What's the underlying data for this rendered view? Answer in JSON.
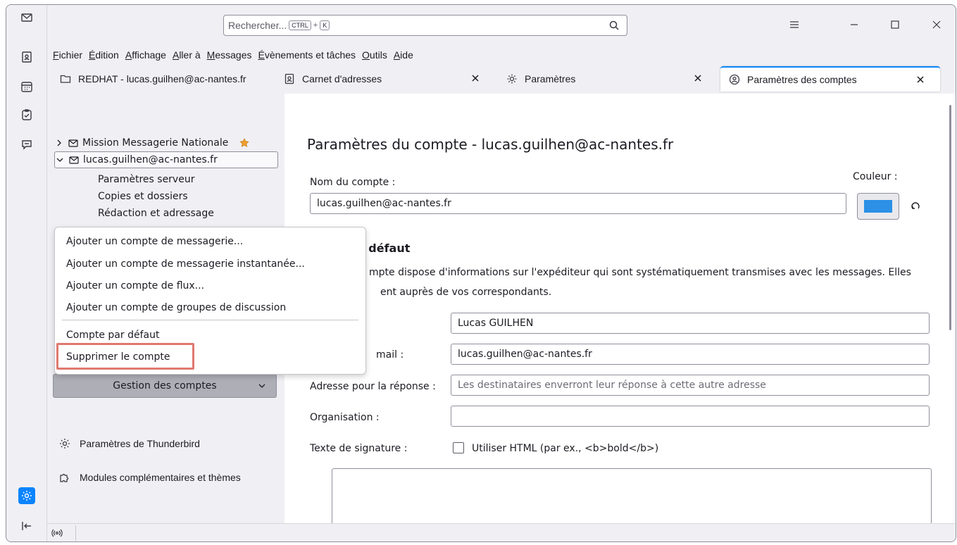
{
  "search": {
    "placeholder": "Rechercher...",
    "kbd_ctrl": "CTRL",
    "kbd_plus": "+",
    "kbd_key": "K"
  },
  "menubar": [
    "Fichier",
    "Édition",
    "Affichage",
    "Aller à",
    "Messages",
    "Évènements et tâches",
    "Outils",
    "Aide"
  ],
  "tabs": [
    {
      "label": "REDHAT - lucas.guilhen@ac-nantes.fr",
      "icon": "folder-icon"
    },
    {
      "label": "Carnet d'adresses",
      "icon": "address-book-icon"
    },
    {
      "label": "Paramètres",
      "icon": "gear-icon"
    },
    {
      "label": "Paramètres des comptes",
      "icon": "account-settings-icon"
    }
  ],
  "sidebar": {
    "accounts": [
      {
        "label": "Mission Messagerie Nationale",
        "expanded": false
      },
      {
        "label": "lucas.guilhen@ac-nantes.fr",
        "expanded": true
      }
    ],
    "subitems": [
      "Paramètres serveur",
      "Copies et dossiers",
      "Rédaction et adressage"
    ],
    "gestion_label": "Gestion des comptes",
    "links": [
      {
        "label": "Paramètres de Thunderbird",
        "icon": "gear-icon"
      },
      {
        "label": "Modules complémentaires et thèmes",
        "icon": "puzzle-icon"
      }
    ]
  },
  "popup": {
    "items": [
      "Ajouter un compte de messagerie...",
      "Ajouter un compte de messagerie instantanée...",
      "Ajouter un compte de flux...",
      "Ajouter un compte de groupes de discussion",
      "Compte par défaut",
      "Supprimer le compte"
    ]
  },
  "main": {
    "title": "Paramètres du compte - lucas.guilhen@ac-nantes.fr",
    "account_name_label": "Nom du compte :",
    "account_name_value": "lucas.guilhen@ac-nantes.fr",
    "color_label": "Couleur :",
    "color_value": "#2b90e6",
    "identity_heading_partial": "ar défaut",
    "identity_desc_line1": "mpte dispose d'informations sur l'expéditeur qui sont systématiquement transmises avec les messages. Elles",
    "identity_desc_line2": "ent auprès de vos correspondants.",
    "name_value": "Lucas GUILHEN",
    "email_label_partial": "mail :",
    "email_value": "lucas.guilhen@ac-nantes.fr",
    "reply_label": "Adresse pour la réponse :",
    "reply_placeholder": "Les destinataires enverront leur réponse à cette autre adresse",
    "org_label": "Organisation :",
    "org_value": "",
    "sig_label": "Texte de signature :",
    "sig_html_label": "Utiliser HTML (par ex., <b>bold</b>)"
  },
  "colors": {
    "accent": "#0a84ff",
    "highlight": "#e0786f"
  }
}
